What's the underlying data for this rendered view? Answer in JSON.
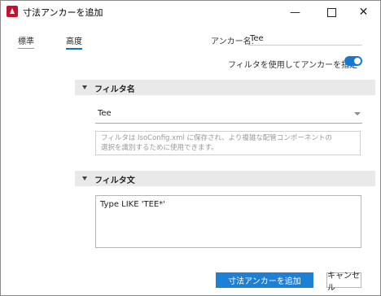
{
  "window": {
    "title": "寸法アンカーを追加",
    "controls": {
      "minimize": "—",
      "close": "✕"
    }
  },
  "tabs": [
    {
      "label": "標準"
    },
    {
      "label": "高度"
    }
  ],
  "anchor": {
    "label": "アンカー名:",
    "value": "Tee"
  },
  "filter_toggle": {
    "label": "フィルタを使用してアンカーを指定",
    "on": true
  },
  "sections": {
    "filter_name": {
      "title": "フィルタ名",
      "selected": "Tee",
      "description_lines": [
        "フィルタは IsoConfig.xml に保存され、より複雑な配管コンポーネントの",
        "選択を識別するために使用できます。"
      ]
    },
    "filter_statement": {
      "title": "フィルタ文",
      "value": "Type LIKE 'TEE*'"
    }
  },
  "buttons": {
    "add": "寸法アンカーを追加",
    "cancel": "キャンセル"
  },
  "colors": {
    "accent": "#1e7fd6",
    "app_icon": "#c8102e",
    "section_bg": "#e9e9e9"
  }
}
